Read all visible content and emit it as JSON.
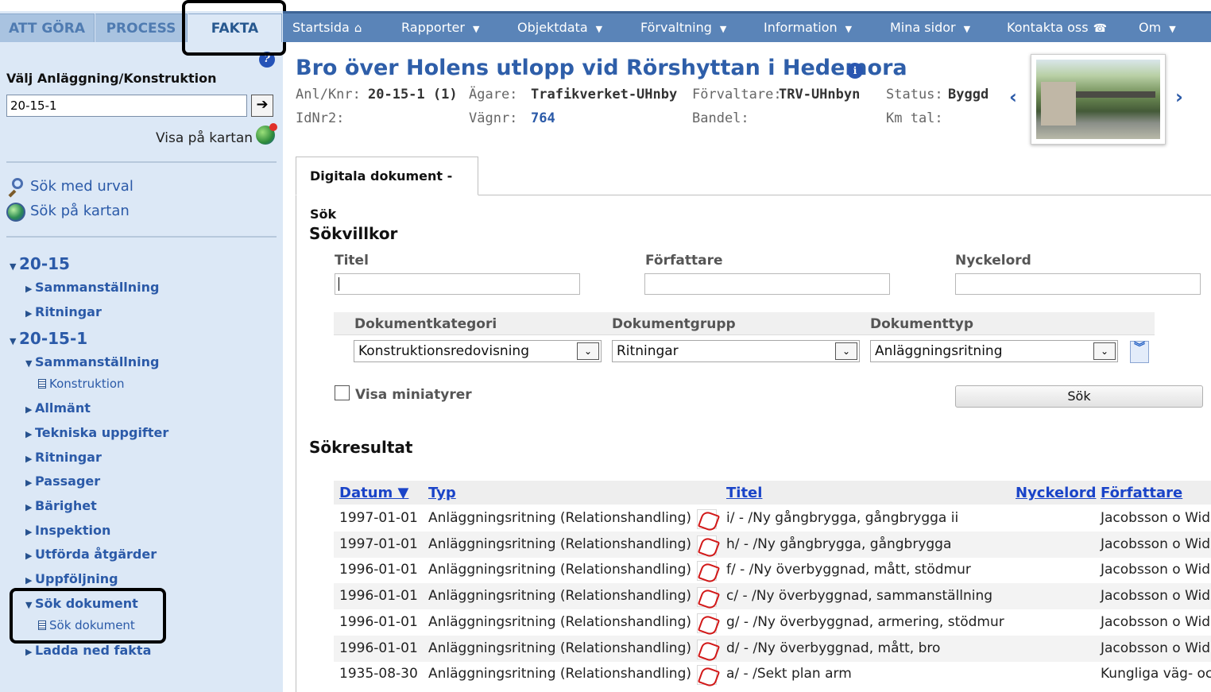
{
  "left_tabs": [
    "ATT GÖRA",
    "PROCESS",
    "FAKTA"
  ],
  "left": {
    "select_label": "Välj Anläggning/Konstruktion",
    "select_value": "20-15-1",
    "go_arrow": "➔",
    "show_on_map": "Visa på kartan",
    "search_with_filter": "Sök med urval",
    "search_on_map": "Sök på kartan",
    "tree": [
      {
        "label": "20-15",
        "level": 0,
        "arrow": "▼"
      },
      {
        "label": "Sammanställning",
        "level": 1,
        "arrow": "▶"
      },
      {
        "label": "Ritningar",
        "level": 1,
        "arrow": "▶"
      },
      {
        "label": "20-15-1",
        "level": 0,
        "arrow": "▼"
      },
      {
        "label": "Sammanställning",
        "level": 1,
        "arrow": "▼"
      },
      {
        "label": "Konstruktion",
        "level": 2,
        "arrow": ""
      },
      {
        "label": "Allmänt",
        "level": 1,
        "arrow": "▶"
      },
      {
        "label": "Tekniska uppgifter",
        "level": 1,
        "arrow": "▶"
      },
      {
        "label": "Ritningar",
        "level": 1,
        "arrow": "▶"
      },
      {
        "label": "Passager",
        "level": 1,
        "arrow": "▶"
      },
      {
        "label": "Bärighet",
        "level": 1,
        "arrow": "▶"
      },
      {
        "label": "Inspektion",
        "level": 1,
        "arrow": "▶"
      },
      {
        "label": "Utförda åtgärder",
        "level": 1,
        "arrow": "▶"
      },
      {
        "label": "Uppföljning",
        "level": 1,
        "arrow": "▶"
      },
      {
        "label": "Sök dokument",
        "level": 1,
        "arrow": "▼"
      },
      {
        "label": "Sök dokument",
        "level": 2,
        "arrow": ""
      },
      {
        "label": "Ladda ned fakta",
        "level": 1,
        "arrow": "▶"
      }
    ]
  },
  "nav": {
    "items": [
      "Startsida",
      "Rapporter",
      "Objektdata",
      "Förvaltning",
      "Information",
      "Mina sidor",
      "Kontakta oss",
      "Om"
    ],
    "home_glyph": "⌂",
    "phone_glyph": "☎",
    "caret": "▼"
  },
  "header": {
    "title": "Bro över Holens utlopp vid Rörshyttan i Hedemora",
    "info_glyph": "i",
    "anlknr_label": "Anl/Knr:",
    "anlknr_value": "20-15-1 (1)",
    "agare_label": "Ägare:",
    "agare_value": "Trafikverket-UHnby",
    "forvaltare_label": "Förvaltare:",
    "forvaltare_value": "TRV-UHnbyn",
    "status_label": "Status:",
    "status_value": "Byggd",
    "idnr2_label": "IdNr2:",
    "vagnr_label": "Vägnr:",
    "vagnr_value": "764",
    "bandel_label": "Bandel:",
    "kmtal_label": "Km tal:",
    "prev_glyph": "‹",
    "next_glyph": "›"
  },
  "panel": {
    "tab_label": "Digitala dokument - Sök",
    "search_title": "Sökvillkor",
    "titel_label": "Titel",
    "forfattare_label": "Författare",
    "nyckelord_label": "Nyckelord",
    "kategori_label": "Dokumentkategori",
    "grupp_label": "Dokumentgrupp",
    "typ_label": "Dokumenttyp",
    "kategori_value": "Konstruktionsredovisning",
    "grupp_value": "Ritningar",
    "typ_value": "Anläggningsritning",
    "select_arrow": "⌄",
    "expand_glyph": "︾",
    "checkbox_label": "Visa miniatyrer",
    "search_button": "Sök",
    "results_title": "Sökresultat"
  },
  "results": {
    "headers": {
      "datum": "Datum ▼",
      "typ": "Typ",
      "titel": "Titel",
      "nyckelord": "Nyckelord",
      "forfattare": "Författare"
    },
    "rows": [
      {
        "datum": "1997-01-01",
        "typ": "Anläggningsritning (Relationshandling)",
        "titel": "i/ - /Ny gångbrygga, gångbrygga ii",
        "forfattare": "Jacobsson o Wid"
      },
      {
        "datum": "1997-01-01",
        "typ": "Anläggningsritning (Relationshandling)",
        "titel": "h/ - /Ny gångbrygga, gångbrygga",
        "forfattare": "Jacobsson o Wid"
      },
      {
        "datum": "1996-01-01",
        "typ": "Anläggningsritning (Relationshandling)",
        "titel": "f/ - /Ny överbyggnad, mått, stödmur",
        "forfattare": "Jacobsson o Wid"
      },
      {
        "datum": "1996-01-01",
        "typ": "Anläggningsritning (Relationshandling)",
        "titel": "c/ - /Ny överbyggnad, sammanställning",
        "forfattare": "Jacobsson o Wid"
      },
      {
        "datum": "1996-01-01",
        "typ": "Anläggningsritning (Relationshandling)",
        "titel": "g/ - /Ny överbyggnad, armering, stödmur",
        "forfattare": "Jacobsson o Wid"
      },
      {
        "datum": "1996-01-01",
        "typ": "Anläggningsritning (Relationshandling)",
        "titel": "d/ - /Ny överbyggnad, mått, bro",
        "forfattare": "Jacobsson o Wid"
      },
      {
        "datum": "1935-08-30",
        "typ": "Anläggningsritning (Relationshandling)",
        "titel": "a/ - /Sekt plan arm",
        "forfattare": "Kungliga väg- oc"
      }
    ]
  }
}
